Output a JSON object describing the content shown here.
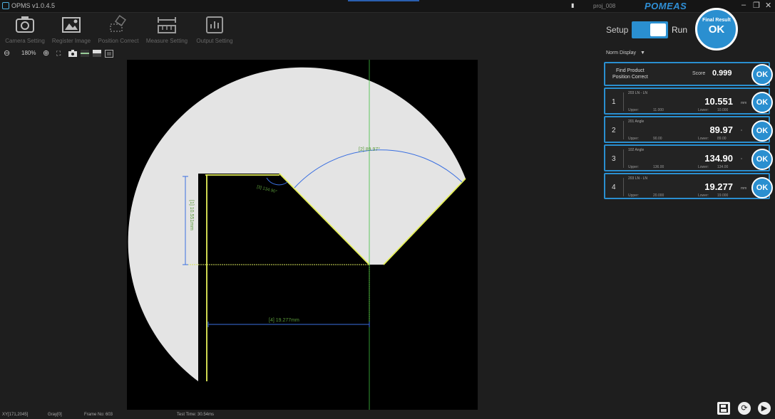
{
  "app": {
    "title": "OPMS v1.0.4.5",
    "project": "proj_008",
    "brand": "POMEAS"
  },
  "toolbar": {
    "items": [
      {
        "label": "Camera Setting"
      },
      {
        "label": "Register Image"
      },
      {
        "label": "Position Correct"
      },
      {
        "label": "Measure Setting"
      },
      {
        "label": "Output Setting"
      }
    ]
  },
  "zoom": {
    "percent": "180%"
  },
  "mode": {
    "setup_label": "Setup",
    "run_label": "Run",
    "run_enabled": true
  },
  "final_result": {
    "label": "Final Result",
    "value": "OK"
  },
  "display_mode": {
    "label": "Norm Display"
  },
  "position_card": {
    "line1": "Find Product",
    "line2": "Position Correct",
    "score_label": "Score",
    "score": "0.999",
    "status": "OK"
  },
  "results": [
    {
      "index": "1",
      "title": "203 LN - LN",
      "value": "10.551",
      "unit": "mm",
      "upper_label": "Upper:",
      "upper": "11.000",
      "lower_label": "Lower:",
      "lower": "10.000",
      "status": "OK"
    },
    {
      "index": "2",
      "title": "201 Angle",
      "value": "89.97",
      "unit": "°",
      "upper_label": "Upper:",
      "upper": "90.00",
      "lower_label": "Lower:",
      "lower": "89.00",
      "status": "OK"
    },
    {
      "index": "3",
      "title": "102 Angle",
      "value": "134.90",
      "unit": "°",
      "upper_label": "Upper:",
      "upper": "136.00",
      "lower_label": "Lower:",
      "lower": "134.00",
      "status": "OK"
    },
    {
      "index": "4",
      "title": "203 LN - LN",
      "value": "19.277",
      "unit": "mm",
      "upper_label": "Upper:",
      "upper": "20.000",
      "lower_label": "Lower:",
      "lower": "19.000",
      "status": "OK"
    }
  ],
  "overlay": {
    "m1": "[1] 10.551mm",
    "m2": "[2] 89.97°",
    "m3": "[3] 134.90°",
    "m4": "[4] 19.277mm"
  },
  "status_bar": {
    "xy": "XY[171,2045]",
    "gray": "Gray[0]",
    "frame": "Frame No: 603",
    "test_time": "Test Time: 30.54ms"
  },
  "colors": {
    "accent": "#2a8fd0",
    "measure_blue": "#3a6fe0",
    "edge_yellow": "#e6f05a",
    "crosshair": "#3fbf3f",
    "brand": "#2f8fd6"
  }
}
